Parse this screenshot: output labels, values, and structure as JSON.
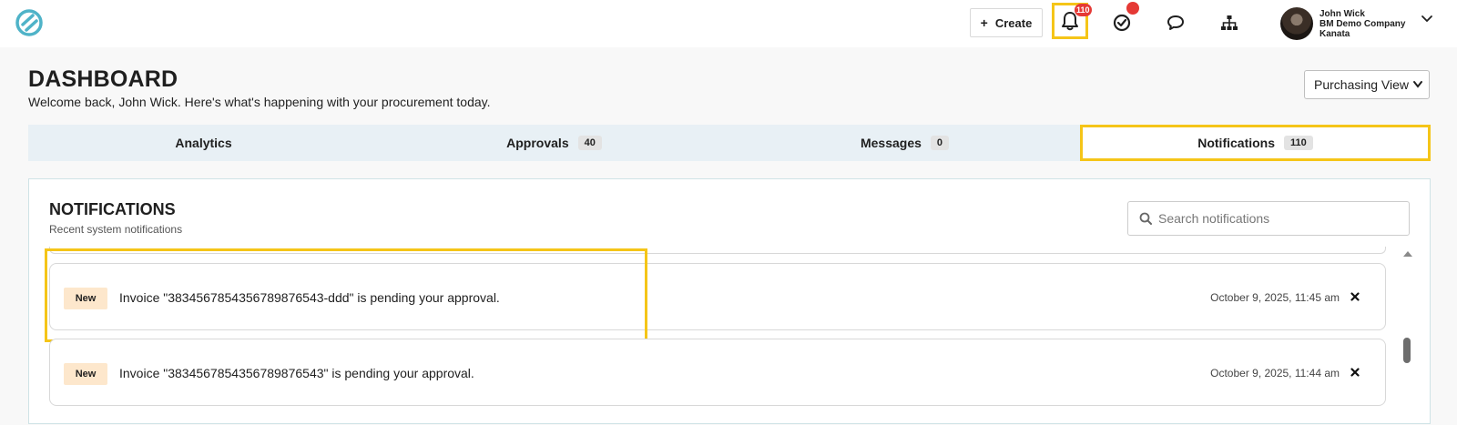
{
  "topbar": {
    "logo_icon": "brand-logo-icon",
    "create_label": "Create",
    "notifications_badge": "110",
    "tasks_icon": "check-circle-icon",
    "chat_icon": "chat-bubble-icon",
    "org_icon": "sitemap-icon",
    "user": {
      "name": "John Wick",
      "company": "BM Demo Company",
      "location": "Kanata"
    },
    "colors": {
      "highlight": "#f5c518",
      "badge": "#e53935",
      "logo": "#4fb3c8"
    }
  },
  "header": {
    "title": "DASHBOARD",
    "subtitle": "Welcome back, John Wick. Here's what's happening with your procurement today.",
    "view_select": "Purchasing View"
  },
  "tabs": [
    {
      "label": "Analytics",
      "count": ""
    },
    {
      "label": "Approvals",
      "count": "40"
    },
    {
      "label": "Messages",
      "count": "0"
    },
    {
      "label": "Notifications",
      "count": "110"
    }
  ],
  "notifications": {
    "title": "NOTIFICATIONS",
    "subtitle": "Recent system notifications",
    "search_placeholder": "Search notifications",
    "items": [
      {
        "badge": "New",
        "text": "Invoice \"383456785435678987654​3-ddd\" is pending your approval.",
        "time": "October 9, 2025, 11:45 am"
      },
      {
        "badge": "New",
        "text": "Invoice \"3834567854356789876543\" is pending your approval.",
        "time": "October 9, 2025, 11:44 am"
      }
    ]
  }
}
